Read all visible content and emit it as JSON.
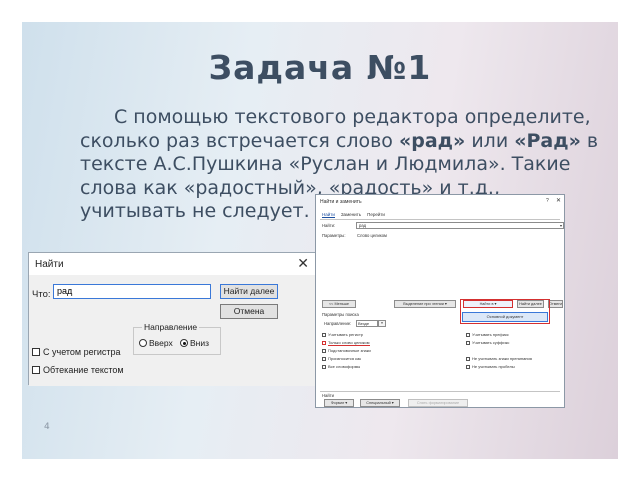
{
  "slide": {
    "title": "Задача №1",
    "body_part1": "С помощью текстового редактора определите, сколько раз встречается слово ",
    "word1": "«рад»",
    "body_or": " или ",
    "word2": "«Рад»",
    "body_part2": " в тексте А.С.Пушкина «Руслан и Людмила». Такие слова как «радостный», «радость» и т.д., учитывать не следует. В ответе укажите",
    "page_number": "4"
  },
  "find_dialog": {
    "title": "Найти",
    "close_glyph": "✕",
    "what_label": "Что:",
    "search_value": "рад",
    "find_next_label": "Найти далее",
    "cancel_label": "Отмена",
    "direction_label": "Направление",
    "up_label": "Вверх",
    "down_label": "Вниз",
    "match_case_label": "С учетом регистра",
    "wrap_label": "Обтекание текстом"
  },
  "replace_dialog": {
    "title": "Найти и заменить",
    "help_glyph": "?",
    "close_glyph": "✕",
    "tabs": [
      "Найти",
      "Заменить",
      "Перейти"
    ],
    "find_label": "Найти:",
    "find_value": "рад",
    "params_label": "Параметры:",
    "params_value": "Слово целиком",
    "less_button": "<< Меньше",
    "highlight_button": "Выделение при чтении ▾",
    "find_in_button": "Найти в ▾",
    "find_next_button": "Найти далее",
    "cancel_button": "Отмена",
    "popup_item": "Основной документ",
    "search_params_label": "Параметры поиска",
    "direction_label": "Направление:",
    "direction_value": "Везде",
    "left_options": [
      "Учитывать регистр",
      "Только слово целиком",
      "Подстановочные знаки",
      "Произносится как",
      "Все словоформы"
    ],
    "right_options": [
      "Учитывать префикс",
      "Учитывать суффикс",
      "Не учитывать знаки препинания",
      "Не учитывать пробелы"
    ],
    "find_section_label": "Найти",
    "format_button": "Формат ▾",
    "special_button": "Специальный ▾",
    "no_format_button": "Снять форматирование"
  }
}
